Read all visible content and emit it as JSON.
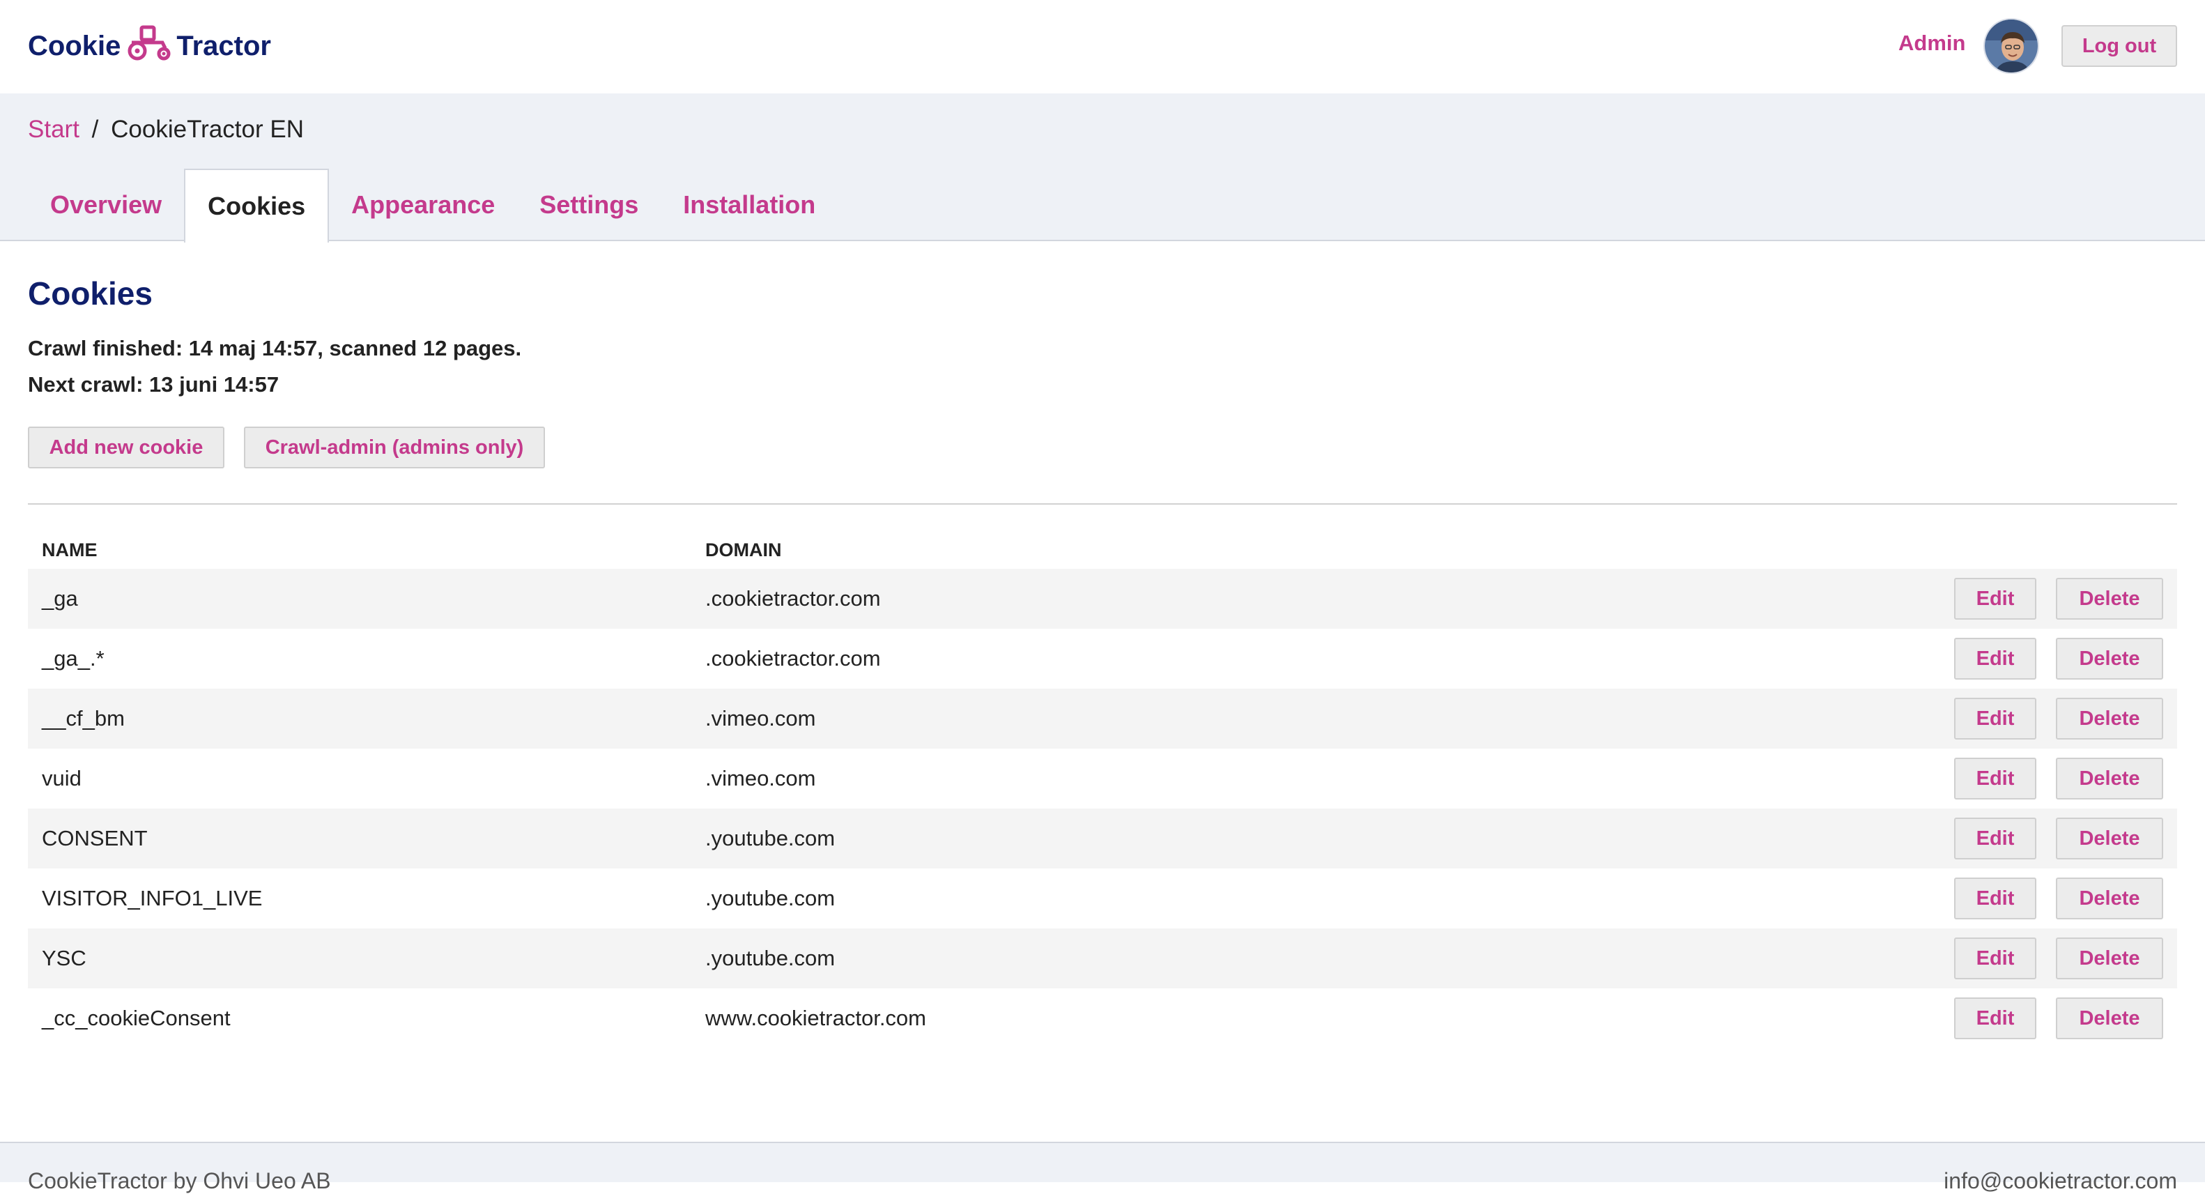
{
  "header": {
    "logo_left": "Cookie",
    "logo_right": "Tractor",
    "user_label": "Admin",
    "logout_label": "Log out"
  },
  "breadcrumb": {
    "root": "Start",
    "separator": "/",
    "current": "CookieTractor EN"
  },
  "tabs": [
    {
      "label": "Overview",
      "active": false
    },
    {
      "label": "Cookies",
      "active": true
    },
    {
      "label": "Appearance",
      "active": false
    },
    {
      "label": "Settings",
      "active": false
    },
    {
      "label": "Installation",
      "active": false
    }
  ],
  "main": {
    "title": "Cookies",
    "crawl_finished": "Crawl finished: 14 maj 14:57, scanned 12 pages.",
    "next_crawl": "Next crawl: 13 juni 14:57",
    "add_button": "Add new cookie",
    "crawl_admin_button": "Crawl-admin (admins only)"
  },
  "table": {
    "headers": {
      "name": "NAME",
      "domain": "DOMAIN"
    },
    "edit_label": "Edit",
    "delete_label": "Delete",
    "rows": [
      {
        "name": "_ga",
        "domain": ".cookietractor.com"
      },
      {
        "name": "_ga_.*",
        "domain": ".cookietractor.com"
      },
      {
        "name": "__cf_bm",
        "domain": ".vimeo.com"
      },
      {
        "name": "vuid",
        "domain": ".vimeo.com"
      },
      {
        "name": "CONSENT",
        "domain": ".youtube.com"
      },
      {
        "name": "VISITOR_INFO1_LIVE",
        "domain": ".youtube.com"
      },
      {
        "name": "YSC",
        "domain": ".youtube.com"
      },
      {
        "name": "_cc_cookieConsent",
        "domain": "www.cookietractor.com"
      }
    ]
  },
  "footer": {
    "left": "CookieTractor by Ohvi Ueo AB",
    "right": "info@cookietractor.com"
  },
  "colors": {
    "accent": "#c43a8c",
    "brand_navy": "#0f1f6b",
    "band_bg": "#eef1f6"
  }
}
